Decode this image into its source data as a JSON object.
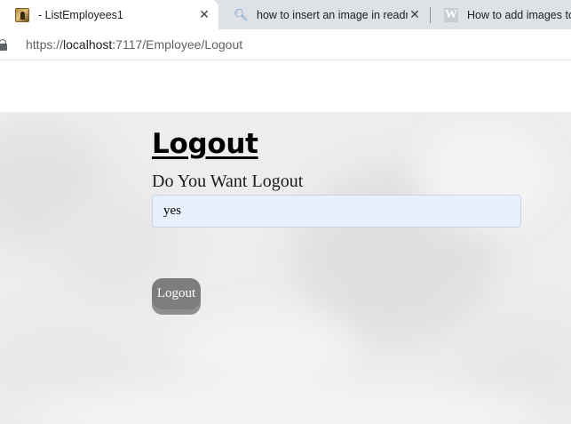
{
  "browser": {
    "tabs": [
      {
        "title": "- ListEmployees1",
        "favicon": "employee-photo-favicon",
        "active": true
      },
      {
        "title": "how to insert an image in readme",
        "favicon": "search-icon",
        "active": false
      },
      {
        "title": "How to add images to",
        "favicon": "w-favicon",
        "active": false
      }
    ],
    "address": {
      "scheme": "https://",
      "host": "localhost",
      "rest": ":7117/Employee/Logout"
    }
  },
  "page": {
    "title": "Logout",
    "prompt": "Do You Want Logout",
    "answer_input": {
      "value": "yes"
    },
    "logout_button": "Logout"
  },
  "colors": {
    "input_background": "#e8f0fe",
    "button_background": "#7d7d7d",
    "page_background": "#ededed"
  }
}
